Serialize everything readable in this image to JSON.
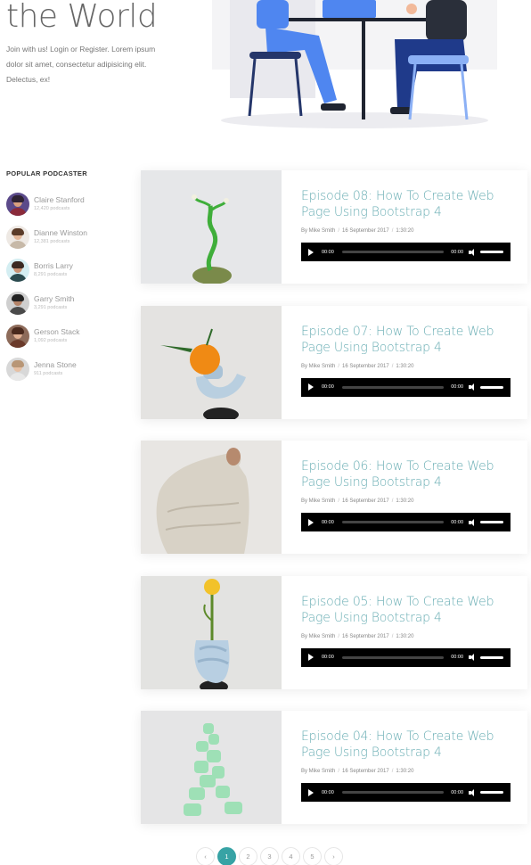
{
  "hero": {
    "title": "the World",
    "text": "Join with us! Login or Register. Lorem ipsum dolor sit amet, consectetur adipisicing elit. Delectus, ex!"
  },
  "sidebar": {
    "heading": "POPULAR PODCASTER",
    "podcasters": [
      {
        "name": "Claire Stanford",
        "count": "12,420 podcasts"
      },
      {
        "name": "Dianne Winston",
        "count": "12,381 podcasts"
      },
      {
        "name": "Borris Larry",
        "count": "8,291 podcasts"
      },
      {
        "name": "Garry Smith",
        "count": "3,291 podcasts"
      },
      {
        "name": "Gerson Stack",
        "count": "1,092 podcasts"
      },
      {
        "name": "Jenna Stone",
        "count": "911 podcasts"
      }
    ]
  },
  "episodes": [
    {
      "title": "Episode 08: How To Create Web Page Using Bootstrap 4",
      "author": "By Mike Smith",
      "date": "16 September 2017",
      "duration": "1:30:20",
      "time_start": "00:00",
      "time_end": "00:00",
      "thumb": "plant-sprout"
    },
    {
      "title": "Episode 07: How To Create Web Page Using Bootstrap 4",
      "author": "By Mike Smith",
      "date": "16 September 2017",
      "duration": "1:30:20",
      "time_start": "00:00",
      "time_end": "00:00",
      "thumb": "orange-on-vase"
    },
    {
      "title": "Episode 06: How To Create Web Page Using Bootstrap 4",
      "author": "By Mike Smith",
      "date": "16 September 2017",
      "duration": "1:30:20",
      "time_start": "00:00",
      "time_end": "00:00",
      "thumb": "knit-sweater"
    },
    {
      "title": "Episode 05: How To Create Web Page Using Bootstrap 4",
      "author": "By Mike Smith",
      "date": "16 September 2017",
      "duration": "1:30:20",
      "time_start": "00:00",
      "time_end": "00:00",
      "thumb": "flower-in-vase"
    },
    {
      "title": "Episode 04: How To Create Web Page Using Bootstrap 4",
      "author": "By Mike Smith",
      "date": "16 September 2017",
      "duration": "1:30:20",
      "time_start": "00:00",
      "time_end": "00:00",
      "thumb": "green-sculpture"
    }
  ],
  "pagination": {
    "prev": "‹",
    "pages": [
      "1",
      "2",
      "3",
      "4",
      "5"
    ],
    "active": "1",
    "next": "›"
  },
  "colors": {
    "accent": "#37a3a5",
    "episode_title": "#6aaeb4",
    "player_bg": "#000000"
  }
}
